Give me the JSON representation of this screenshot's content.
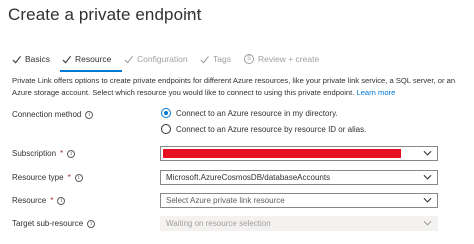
{
  "header": {
    "title": "Create a private endpoint",
    "more_label": "···"
  },
  "steps": [
    {
      "label": "Basics",
      "state": "done"
    },
    {
      "label": "Resource",
      "state": "active"
    },
    {
      "label": "Configuration",
      "state": "disabled"
    },
    {
      "label": "Tags",
      "state": "disabled"
    },
    {
      "label": "Review + create",
      "state": "disabled",
      "number": "5"
    }
  ],
  "description": {
    "text": "Private Link offers options to create private endpoints for different Azure resources, like your private link service, a SQL server, or an Azure storage account. Select which resource you would like to connect to using this private endpoint.",
    "link": "Learn more"
  },
  "form": {
    "connection_method": {
      "label": "Connection method",
      "options": [
        {
          "label": "Connect to an Azure resource in my directory.",
          "selected": true
        },
        {
          "label": "Connect to an Azure resource by resource ID or alias.",
          "selected": false
        }
      ]
    },
    "subscription": {
      "label": "Subscription",
      "required": "*",
      "redacted_color": "#e81123"
    },
    "resource_type": {
      "label": "Resource type",
      "required": "*",
      "value": "Microsoft.AzureCosmosDB/databaseAccounts"
    },
    "resource": {
      "label": "Resource",
      "required": "*",
      "placeholder": "Select Azure private link resource"
    },
    "target_sub_resource": {
      "label": "Target sub-resource",
      "placeholder": "Waiting on resource selection"
    }
  },
  "colors": {
    "accent": "#0078d4",
    "required": "#a4262c"
  }
}
